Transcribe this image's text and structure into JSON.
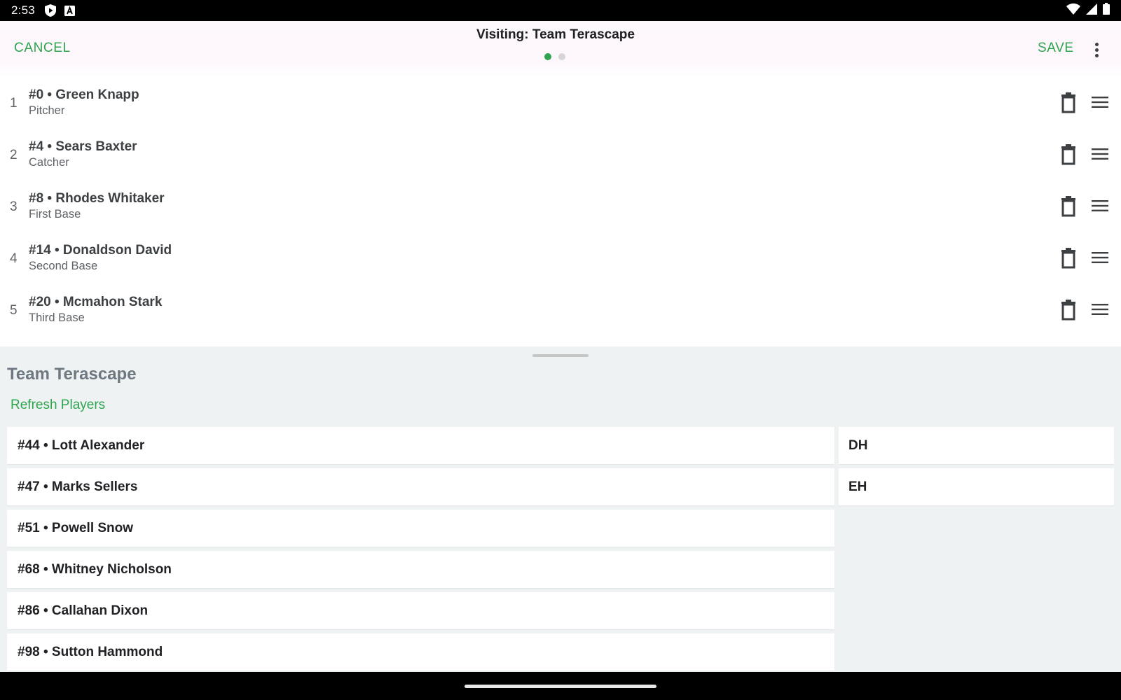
{
  "status_bar": {
    "time": "2:53"
  },
  "app_bar": {
    "cancel_label": "CANCEL",
    "save_label": "SAVE",
    "title": "Visiting: Team Terascape",
    "accent_color": "#2ea44f"
  },
  "lineup": [
    {
      "index": "1",
      "name": "#0 • Green Knapp",
      "position": "Pitcher"
    },
    {
      "index": "2",
      "name": "#4 • Sears Baxter",
      "position": "Catcher"
    },
    {
      "index": "3",
      "name": "#8 • Rhodes Whitaker",
      "position": "First Base"
    },
    {
      "index": "4",
      "name": "#14 • Donaldson David",
      "position": "Second Base"
    },
    {
      "index": "5",
      "name": "#20 • Mcmahon Stark",
      "position": "Third Base"
    }
  ],
  "sheet": {
    "team_name": "Team Terascape",
    "refresh_label": "Refresh Players",
    "bench": [
      "#44 • Lott Alexander",
      "#47 • Marks Sellers",
      "#51 • Powell Snow",
      "#68 • Whitney Nicholson",
      "#86 • Callahan Dixon",
      "#98 • Sutton Hammond"
    ],
    "positions": [
      "DH",
      "EH"
    ]
  },
  "icons": {
    "status": [
      "shield-play-icon",
      "text-a-icon",
      "wifi-icon",
      "signal-icon",
      "battery-icon"
    ],
    "row_actions": [
      "trash-icon",
      "drag-handle-icon"
    ],
    "menu": "more-vert-icon"
  }
}
